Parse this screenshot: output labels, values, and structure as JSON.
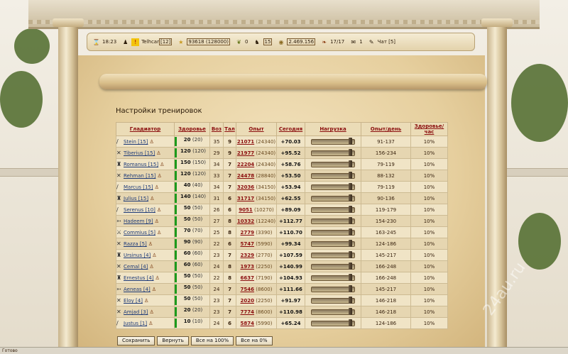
{
  "status_bar": {
    "time": "18:23",
    "player_name": "Telhcar",
    "player_level": "[12]",
    "fame": "93618 (128000)",
    "laurels": "0",
    "gladiators": "15",
    "money": "2.469.156",
    "food": "17/17",
    "mail": "1",
    "chat": "Чат [5]"
  },
  "page_title": "Настройки тренировок",
  "table": {
    "headers": [
      "Гладиатор",
      "Здоровье",
      "Воз",
      "Тал",
      "Опыт",
      "Сегодня",
      "Нагрузка",
      "Опыт/день",
      "Здоровье/час"
    ],
    "rows": [
      {
        "type": "sword",
        "name": "Stein [15]",
        "hp": "20",
        "hp_max": "(20)",
        "age": "35",
        "talent": "9",
        "exp": "21071",
        "exp_next": "(24340)",
        "today": "+70.03",
        "load": 0.95,
        "exp_day": "91-137",
        "hp_hour": "10%"
      },
      {
        "type": "cross",
        "name": "Tiberius [15]",
        "hp": "120",
        "hp_max": "(120)",
        "age": "29",
        "talent": "9",
        "exp": "21977",
        "exp_next": "(24340)",
        "today": "+95.52",
        "load": 0.95,
        "exp_day": "156-234",
        "hp_hour": "10%"
      },
      {
        "type": "helmet",
        "name": "Romanus [15]",
        "hp": "150",
        "hp_max": "(150)",
        "age": "34",
        "talent": "7",
        "exp": "22204",
        "exp_next": "(24340)",
        "today": "+58.76",
        "load": 0.95,
        "exp_day": "79-119",
        "hp_hour": "10%"
      },
      {
        "type": "cross",
        "name": "Rehman [15]",
        "hp": "120",
        "hp_max": "(120)",
        "age": "33",
        "talent": "7",
        "exp": "24478",
        "exp_next": "(28840)",
        "today": "+53.50",
        "load": 0.95,
        "exp_day": "88-132",
        "hp_hour": "10%"
      },
      {
        "type": "sword",
        "name": "Marcus [15]",
        "hp": "40",
        "hp_max": "(40)",
        "age": "34",
        "talent": "7",
        "exp": "32036",
        "exp_next": "(34150)",
        "today": "+53.94",
        "load": 0.95,
        "exp_day": "79-119",
        "hp_hour": "10%"
      },
      {
        "type": "helmet",
        "name": "Julius [15]",
        "hp": "140",
        "hp_max": "(140)",
        "age": "31",
        "talent": "6",
        "exp": "31717",
        "exp_next": "(34150)",
        "today": "+62.55",
        "load": 0.95,
        "exp_day": "90-136",
        "hp_hour": "10%"
      },
      {
        "type": "sword",
        "name": "Serenus [10]",
        "hp": "50",
        "hp_max": "(50)",
        "age": "26",
        "talent": "6",
        "exp": "9051",
        "exp_next": "(10270)",
        "today": "+89.09",
        "load": 0.95,
        "exp_day": "119-179",
        "hp_hour": "10%"
      },
      {
        "type": "spear",
        "name": "Hadeem [9]",
        "hp": "50",
        "hp_max": "(50)",
        "age": "27",
        "talent": "8",
        "exp": "10332",
        "exp_next": "(12240)",
        "today": "+112.77",
        "load": 0.95,
        "exp_day": "154-230",
        "hp_hour": "10%"
      },
      {
        "type": "fish",
        "name": "Commius [5]",
        "hp": "70",
        "hp_max": "(70)",
        "age": "25",
        "talent": "8",
        "exp": "2779",
        "exp_next": "(3390)",
        "today": "+110.70",
        "load": 0.95,
        "exp_day": "163-245",
        "hp_hour": "10%"
      },
      {
        "type": "cross",
        "name": "Razza [5]",
        "hp": "90",
        "hp_max": "(90)",
        "age": "22",
        "talent": "6",
        "exp": "5747",
        "exp_next": "(5990)",
        "today": "+99.34",
        "load": 0.95,
        "exp_day": "124-186",
        "hp_hour": "10%"
      },
      {
        "type": "helmet",
        "name": "Ursinus [4]",
        "hp": "60",
        "hp_max": "(60)",
        "age": "23",
        "talent": "7",
        "exp": "2329",
        "exp_next": "(2770)",
        "today": "+107.59",
        "load": 0.95,
        "exp_day": "145-217",
        "hp_hour": "10%"
      },
      {
        "type": "cross",
        "name": "Cemal [4]",
        "hp": "60",
        "hp_max": "(60)",
        "age": "24",
        "talent": "8",
        "exp": "1973",
        "exp_next": "(2250)",
        "today": "+140.99",
        "load": 0.95,
        "exp_day": "166-248",
        "hp_hour": "10%"
      },
      {
        "type": "helmet",
        "name": "Ernestus [4]",
        "hp": "50",
        "hp_max": "(50)",
        "age": "22",
        "talent": "8",
        "exp": "6637",
        "exp_next": "(7190)",
        "today": "+104.93",
        "load": 0.95,
        "exp_day": "166-248",
        "hp_hour": "10%"
      },
      {
        "type": "spear",
        "name": "Aeneas [4]",
        "hp": "50",
        "hp_max": "(50)",
        "age": "24",
        "talent": "7",
        "exp": "7546",
        "exp_next": "(8600)",
        "today": "+111.66",
        "load": 0.95,
        "exp_day": "145-217",
        "hp_hour": "10%"
      },
      {
        "type": "cross",
        "name": "Eloy [4]",
        "hp": "50",
        "hp_max": "(50)",
        "age": "23",
        "talent": "7",
        "exp": "2020",
        "exp_next": "(2250)",
        "today": "+91.97",
        "load": 0.95,
        "exp_day": "146-218",
        "hp_hour": "10%"
      },
      {
        "type": "cross",
        "name": "Amjad [3]",
        "hp": "20",
        "hp_max": "(20)",
        "age": "23",
        "talent": "7",
        "exp": "7774",
        "exp_next": "(8600)",
        "today": "+110.98",
        "load": 0.95,
        "exp_day": "146-218",
        "hp_hour": "10%"
      },
      {
        "type": "sword",
        "name": "Justus [1]",
        "hp": "10",
        "hp_max": "(10)",
        "age": "24",
        "talent": "6",
        "exp": "5874",
        "exp_next": "(5990)",
        "today": "+65.24",
        "load": 0.95,
        "exp_day": "124-186",
        "hp_hour": "10%"
      }
    ]
  },
  "buttons": {
    "save": "Сохранить",
    "revert": "Вернуть",
    "all_100": "Все на 100%",
    "all_0": "Все на 0%"
  },
  "browser_status": "Готово",
  "watermark": "24au.ru",
  "icons": {
    "sword": "/",
    "cross": "✕",
    "helmet": "♜",
    "spear": "➳",
    "fish": "⚔"
  }
}
